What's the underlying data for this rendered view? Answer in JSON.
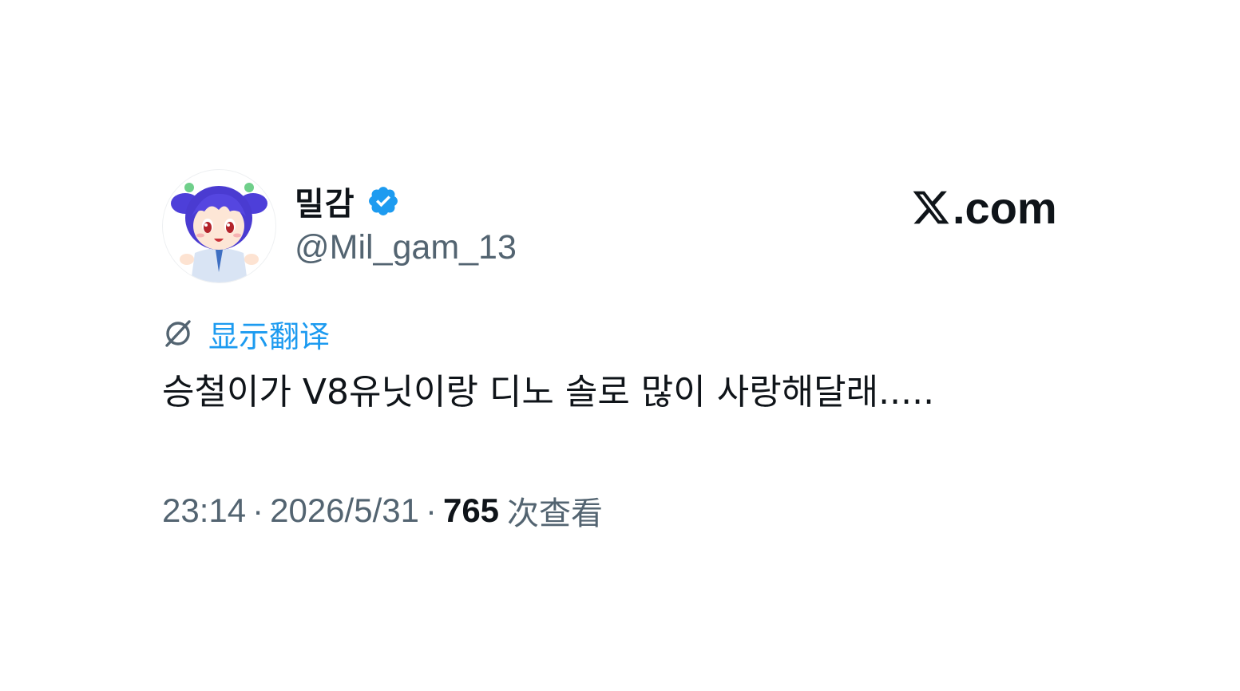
{
  "author": {
    "display_name": "밀감",
    "handle": "@Mil_gam_13",
    "verified": true,
    "verified_badge_icon": "verified-badge-icon",
    "avatar_icon": "anime-girl-avatar"
  },
  "brand": {
    "logo_icon": "x-logo-icon",
    "logo_suffix": ".com"
  },
  "translate": {
    "icon": "globe-translate-icon",
    "label": "显示翻译"
  },
  "tweet": {
    "text": "승철이가 V8유닛이랑 디노 솔로 많이 사랑해달래....."
  },
  "meta": {
    "time": "23:14",
    "separator": "·",
    "date": "2026/5/31",
    "views_count": "765",
    "views_label": "次查看"
  },
  "colors": {
    "link_blue": "#1d9bf0",
    "verified_blue": "#1d9bf0",
    "text_primary": "#0f1419",
    "text_secondary": "#536471",
    "background": "#ffffff"
  }
}
